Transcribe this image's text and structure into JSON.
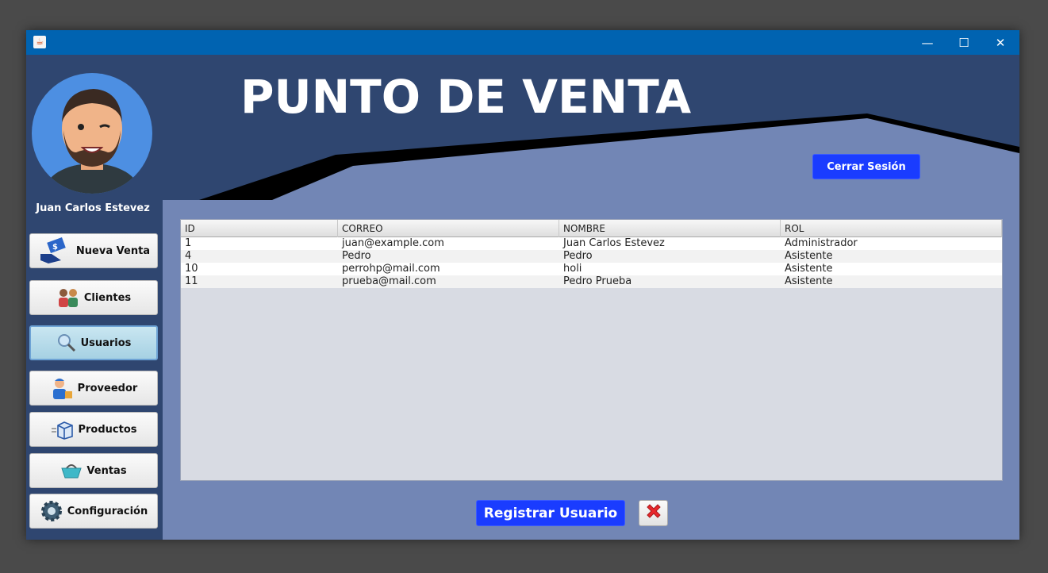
{
  "window": {
    "title_icon": "java-icon",
    "controls": {
      "minimize": "—",
      "maximize": "☐",
      "close": "✕"
    }
  },
  "header": {
    "title": "PUNTO DE VENTA",
    "logout_label": "Cerrar Sesión"
  },
  "user": {
    "name": "Juan Carlos Estevez"
  },
  "sidebar": {
    "items": [
      {
        "label": "Nueva Venta",
        "icon": "sale-hand-icon"
      },
      {
        "label": "Clientes",
        "icon": "clients-icon"
      },
      {
        "label": "Usuarios",
        "icon": "magnifier-icon",
        "active": true
      },
      {
        "label": "Proveedor",
        "icon": "delivery-man-icon"
      },
      {
        "label": "Productos",
        "icon": "box-icon"
      },
      {
        "label": "Ventas",
        "icon": "basket-icon"
      },
      {
        "label": "Configuración",
        "icon": "gear-icon"
      }
    ]
  },
  "table": {
    "columns": [
      "ID",
      "CORREO",
      "NOMBRE",
      "ROL"
    ],
    "rows": [
      [
        "1",
        "juan@example.com",
        "Juan Carlos Estevez",
        "Administrador"
      ],
      [
        "4",
        "Pedro",
        "Pedro",
        "Asistente"
      ],
      [
        "10",
        "perrohp@mail.com",
        "holi",
        "Asistente"
      ],
      [
        "11",
        "prueba@mail.com",
        "Pedro Prueba",
        "Asistente"
      ]
    ]
  },
  "actions": {
    "register_label": "Registrar Usuario",
    "delete_icon": "red-x-icon"
  },
  "colors": {
    "titlebar": "#0063b1",
    "header_dark": "#2f4670",
    "content_bg": "#7286b5",
    "button_blue": "#1a3cff"
  }
}
